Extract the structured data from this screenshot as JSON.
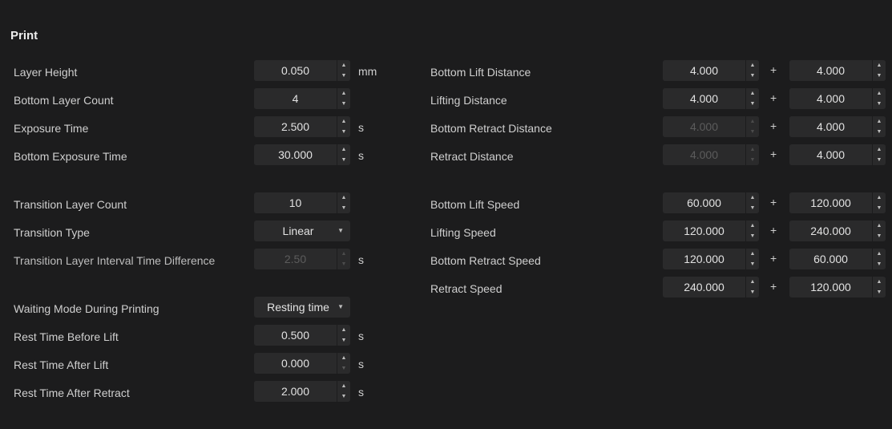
{
  "section": {
    "title": "Print"
  },
  "left": {
    "layer_height": {
      "label": "Layer Height",
      "value": "0.050",
      "unit": "mm"
    },
    "bottom_layer_count": {
      "label": "Bottom Layer Count",
      "value": "4"
    },
    "exposure_time": {
      "label": "Exposure Time",
      "value": "2.500",
      "unit": "s"
    },
    "bottom_exposure_time": {
      "label": "Bottom Exposure Time",
      "value": "30.000",
      "unit": "s"
    },
    "transition_layer_count": {
      "label": "Transition Layer Count",
      "value": "10"
    },
    "transition_type": {
      "label": "Transition Type",
      "value": "Linear"
    },
    "transition_interval": {
      "label": "Transition Layer Interval Time Difference",
      "value": "2.50",
      "unit": "s"
    },
    "waiting_mode": {
      "label": "Waiting Mode During Printing",
      "value": "Resting time"
    },
    "rest_before_lift": {
      "label": "Rest Time Before Lift",
      "value": "0.500",
      "unit": "s"
    },
    "rest_after_lift": {
      "label": "Rest Time After Lift",
      "value": "0.000",
      "unit": "s"
    },
    "rest_after_retract": {
      "label": "Rest Time After Retract",
      "value": "2.000",
      "unit": "s"
    }
  },
  "right": {
    "plus_sign": "+",
    "bottom_lift_distance": {
      "label": "Bottom Lift Distance",
      "value1": "4.000",
      "value2": "4.000"
    },
    "lifting_distance": {
      "label": "Lifting Distance",
      "value1": "4.000",
      "value2": "4.000"
    },
    "bottom_retract_distance": {
      "label": "Bottom Retract Distance",
      "value1": "4.000",
      "value2": "4.000"
    },
    "retract_distance": {
      "label": "Retract Distance",
      "value1": "4.000",
      "value2": "4.000"
    },
    "bottom_lift_speed": {
      "label": "Bottom Lift Speed",
      "value1": "60.000",
      "value2": "120.000"
    },
    "lifting_speed": {
      "label": "Lifting Speed",
      "value1": "120.000",
      "value2": "240.000"
    },
    "bottom_retract_speed": {
      "label": "Bottom Retract Speed",
      "value1": "120.000",
      "value2": "60.000"
    },
    "retract_speed": {
      "label": "Retract Speed",
      "value1": "240.000",
      "value2": "120.000"
    }
  }
}
